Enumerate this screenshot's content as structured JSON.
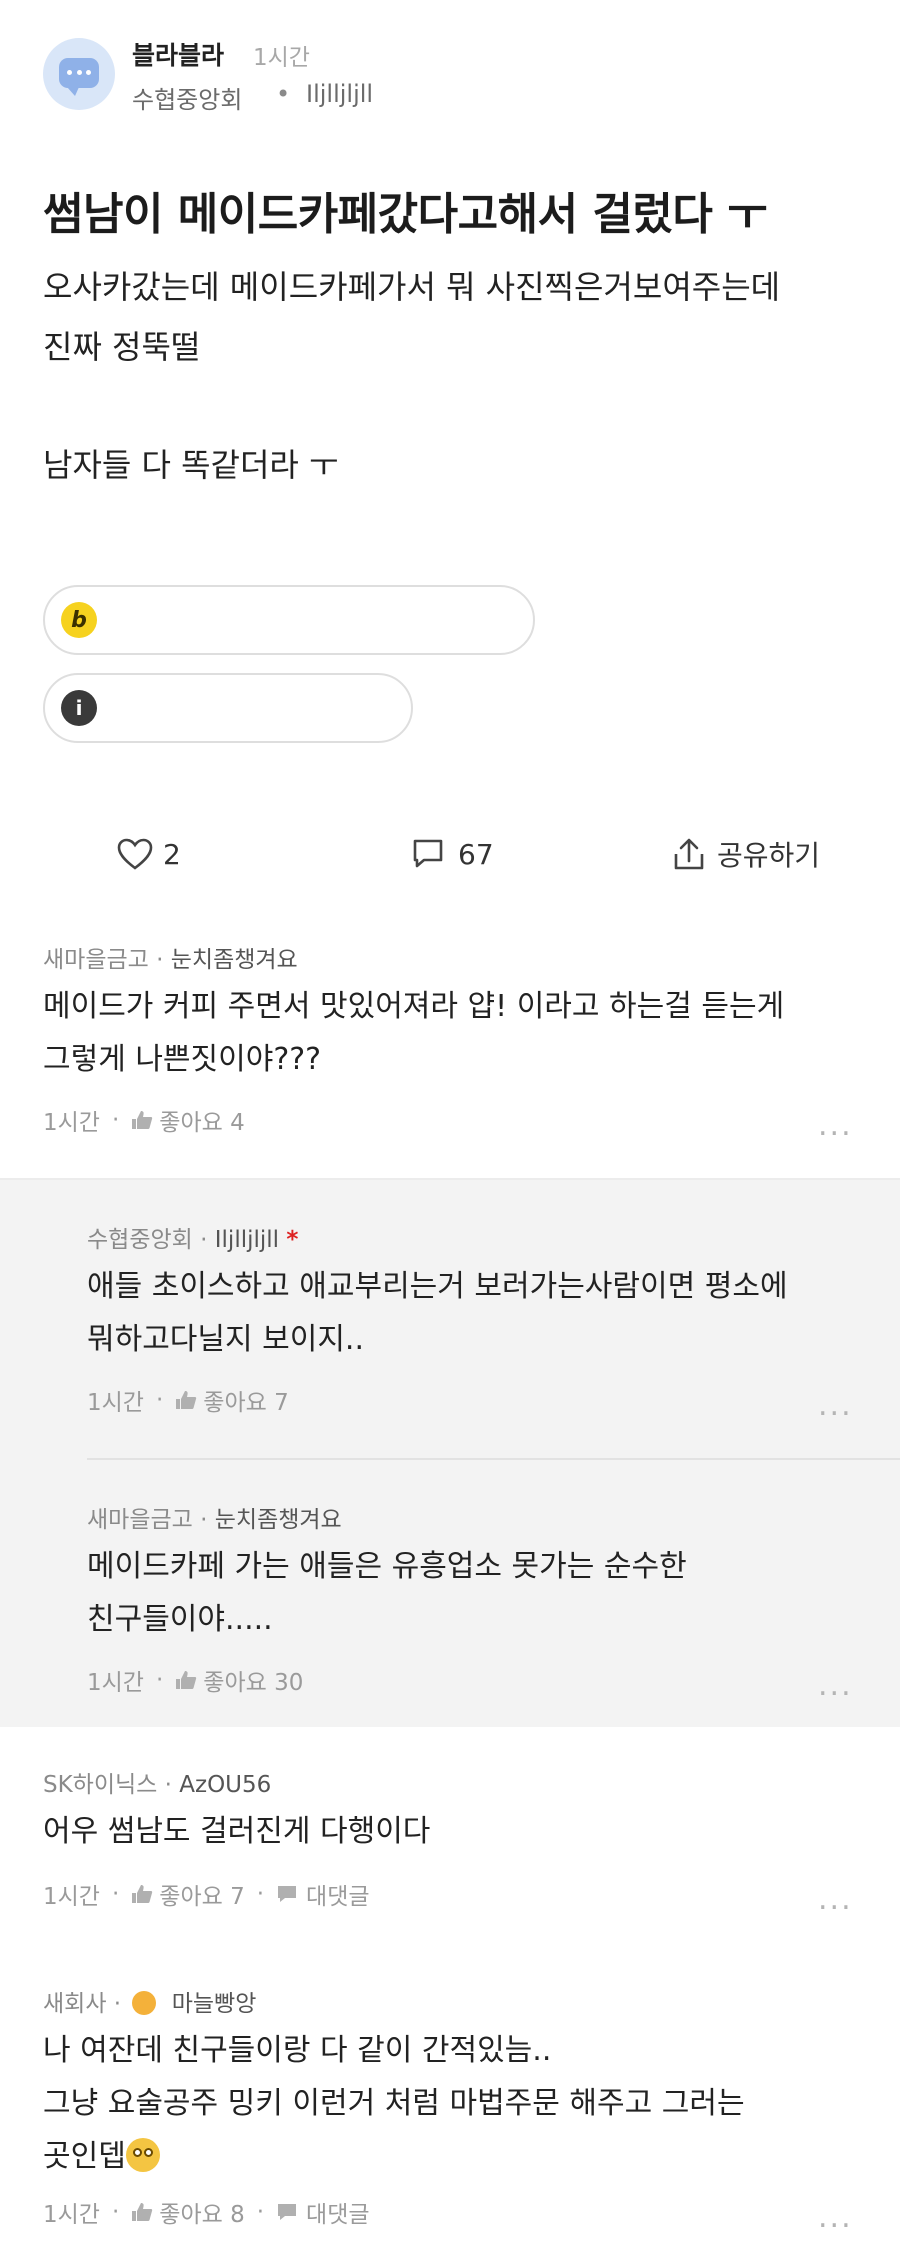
{
  "post": {
    "board": "블라블라",
    "time": "1시간",
    "company": "수협중앙회",
    "separator": "•",
    "nickname": "Iljlljljll",
    "title": "썸남이 메이드카페갔다고해서 걸렀다 ㅜ",
    "body": [
      "오사카갔는데 메이드카페가서 뭐 사진찍은거보여주는데",
      "진짜 정뚝떨",
      "남자들 다 똑같더라 ㅜ"
    ],
    "likes": "2",
    "comments": "67",
    "share_label": "공유하기"
  },
  "comments": [
    {
      "company": "새마을금고",
      "nickname": "눈치좀챙겨요",
      "lines": [
        "메이드가 커피 주면서 맛있어져라 얍!  이라고 하는걸 듣는게",
        "그렇게 나쁜짓이야???"
      ],
      "time": "1시간",
      "like_label": "좋아요 4"
    },
    {
      "company": "수협중앙회",
      "nickname": "Iljlljljll",
      "author_mark": "*",
      "lines": [
        "애들 초이스하고 애교부리는거 보러가는사람이면 평소에",
        "뭐하고다닐지 보이지.."
      ],
      "time": "1시간",
      "like_label": "좋아요 7"
    },
    {
      "company": "새마을금고",
      "nickname": "눈치좀챙겨요",
      "lines": [
        "메이드카페 가는 애들은 유흥업소 못가는 순수한",
        "친구들이야....."
      ],
      "time": "1시간",
      "like_label": "좋아요 30"
    },
    {
      "company": "SK하이닉스",
      "nickname": "AzOU56",
      "lines": [
        "어우 썸남도 걸러진게 다행이다"
      ],
      "time": "1시간",
      "like_label": "좋아요 7",
      "reply_label": "대댓글"
    },
    {
      "company": "새회사",
      "nickname": "마늘빵앙",
      "lines": [
        "나 여잔데 친구들이랑 다 같이 간적있늠..",
        "그냥 요술공주 밍키 이런거 처럼 마법주문 해주고 그러는",
        "곳인뎁"
      ],
      "time": "1시간",
      "like_label": "좋아요 8",
      "reply_label": "대댓글"
    }
  ],
  "ui": {
    "dot": "·",
    "more": "...",
    "colors": {
      "pill_b": "#f6d21f",
      "pill_info": "#3a3a3a",
      "reply_bg": "#f3f3f3",
      "author_mark": "#dd2222"
    },
    "icons": [
      "heart-icon",
      "comment-icon",
      "share-icon",
      "thumb-up-icon",
      "reply-bubble-icon",
      "more-icon"
    ]
  }
}
